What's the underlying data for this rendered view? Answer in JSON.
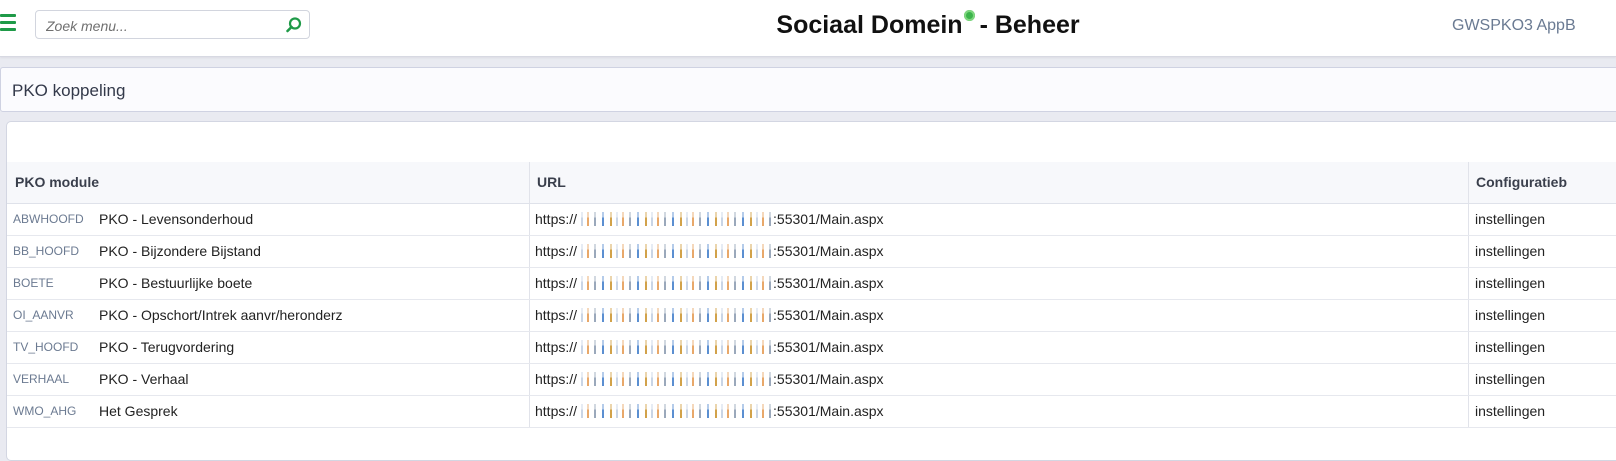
{
  "header": {
    "search_placeholder": "Zoek menu...",
    "title_left": "Sociaal Domein",
    "title_right": "- Beheer",
    "server": "GWSPKO3 AppB",
    "accent": "#1f9a48"
  },
  "page": {
    "title": "PKO koppeling"
  },
  "grid": {
    "columns": [
      "PKO module",
      "URL",
      "Configuratieb"
    ],
    "rows": [
      {
        "code": "ABWHOOFD",
        "name": "PKO - Levensonderhoud",
        "url_prefix": "https://",
        "url_suffix": ":55301/Main.aspx",
        "config": "instellingen"
      },
      {
        "code": "BB_HOOFD",
        "name": "PKO - Bijzondere Bijstand",
        "url_prefix": "https://",
        "url_suffix": ":55301/Main.aspx",
        "config": "instellingen"
      },
      {
        "code": "BOETE",
        "name": "PKO - Bestuurlijke boete",
        "url_prefix": "https://",
        "url_suffix": ":55301/Main.aspx",
        "config": "instellingen"
      },
      {
        "code": "OI_AANVR",
        "name": "PKO - Opschort/Intrek aanvr/heronderz",
        "url_prefix": "https://",
        "url_suffix": ":55301/Main.aspx",
        "config": "instellingen"
      },
      {
        "code": "TV_HOOFD",
        "name": "PKO - Terugvordering",
        "url_prefix": "https://",
        "url_suffix": ":55301/Main.aspx",
        "config": "instellingen"
      },
      {
        "code": "VERHAAL",
        "name": "PKO - Verhaal",
        "url_prefix": "https://",
        "url_suffix": ":55301/Main.aspx",
        "config": "instellingen"
      },
      {
        "code": "WMO_AHG",
        "name": "Het Gesprek",
        "url_prefix": "https://",
        "url_suffix": ":55301/Main.aspx",
        "config": "instellingen"
      }
    ]
  }
}
